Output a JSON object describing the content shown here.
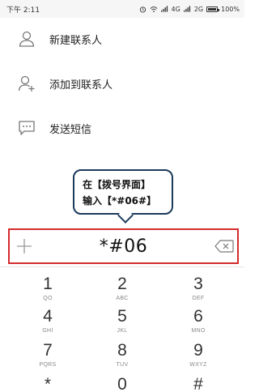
{
  "status_bar": {
    "time": "下午 2:11",
    "network1": "4G",
    "network2": "2G",
    "battery": "100%"
  },
  "options": [
    {
      "label": "新建联系人",
      "icon": "add-contact-icon"
    },
    {
      "label": "添加到联系人",
      "icon": "add-to-contact-icon"
    },
    {
      "label": "发送短信",
      "icon": "message-icon"
    }
  ],
  "callout": {
    "line1": "在【拨号界面】",
    "line2": "输入【*#06#】"
  },
  "dialer": {
    "input_value": "*#06"
  },
  "keypad": [
    {
      "digit": "1",
      "letters": "QO"
    },
    {
      "digit": "2",
      "letters": "ABC"
    },
    {
      "digit": "3",
      "letters": "DEF"
    },
    {
      "digit": "4",
      "letters": "GHI"
    },
    {
      "digit": "5",
      "letters": "JKL"
    },
    {
      "digit": "6",
      "letters": "MNO"
    },
    {
      "digit": "7",
      "letters": "PQRS"
    },
    {
      "digit": "8",
      "letters": "TUV"
    },
    {
      "digit": "9",
      "letters": "WXYZ"
    },
    {
      "digit": "*",
      "letters": ""
    },
    {
      "digit": "0",
      "letters": ""
    },
    {
      "digit": "#",
      "letters": ""
    }
  ],
  "colors": {
    "highlight_border": "#d42b2b",
    "callout_border": "#1c3a5a"
  }
}
